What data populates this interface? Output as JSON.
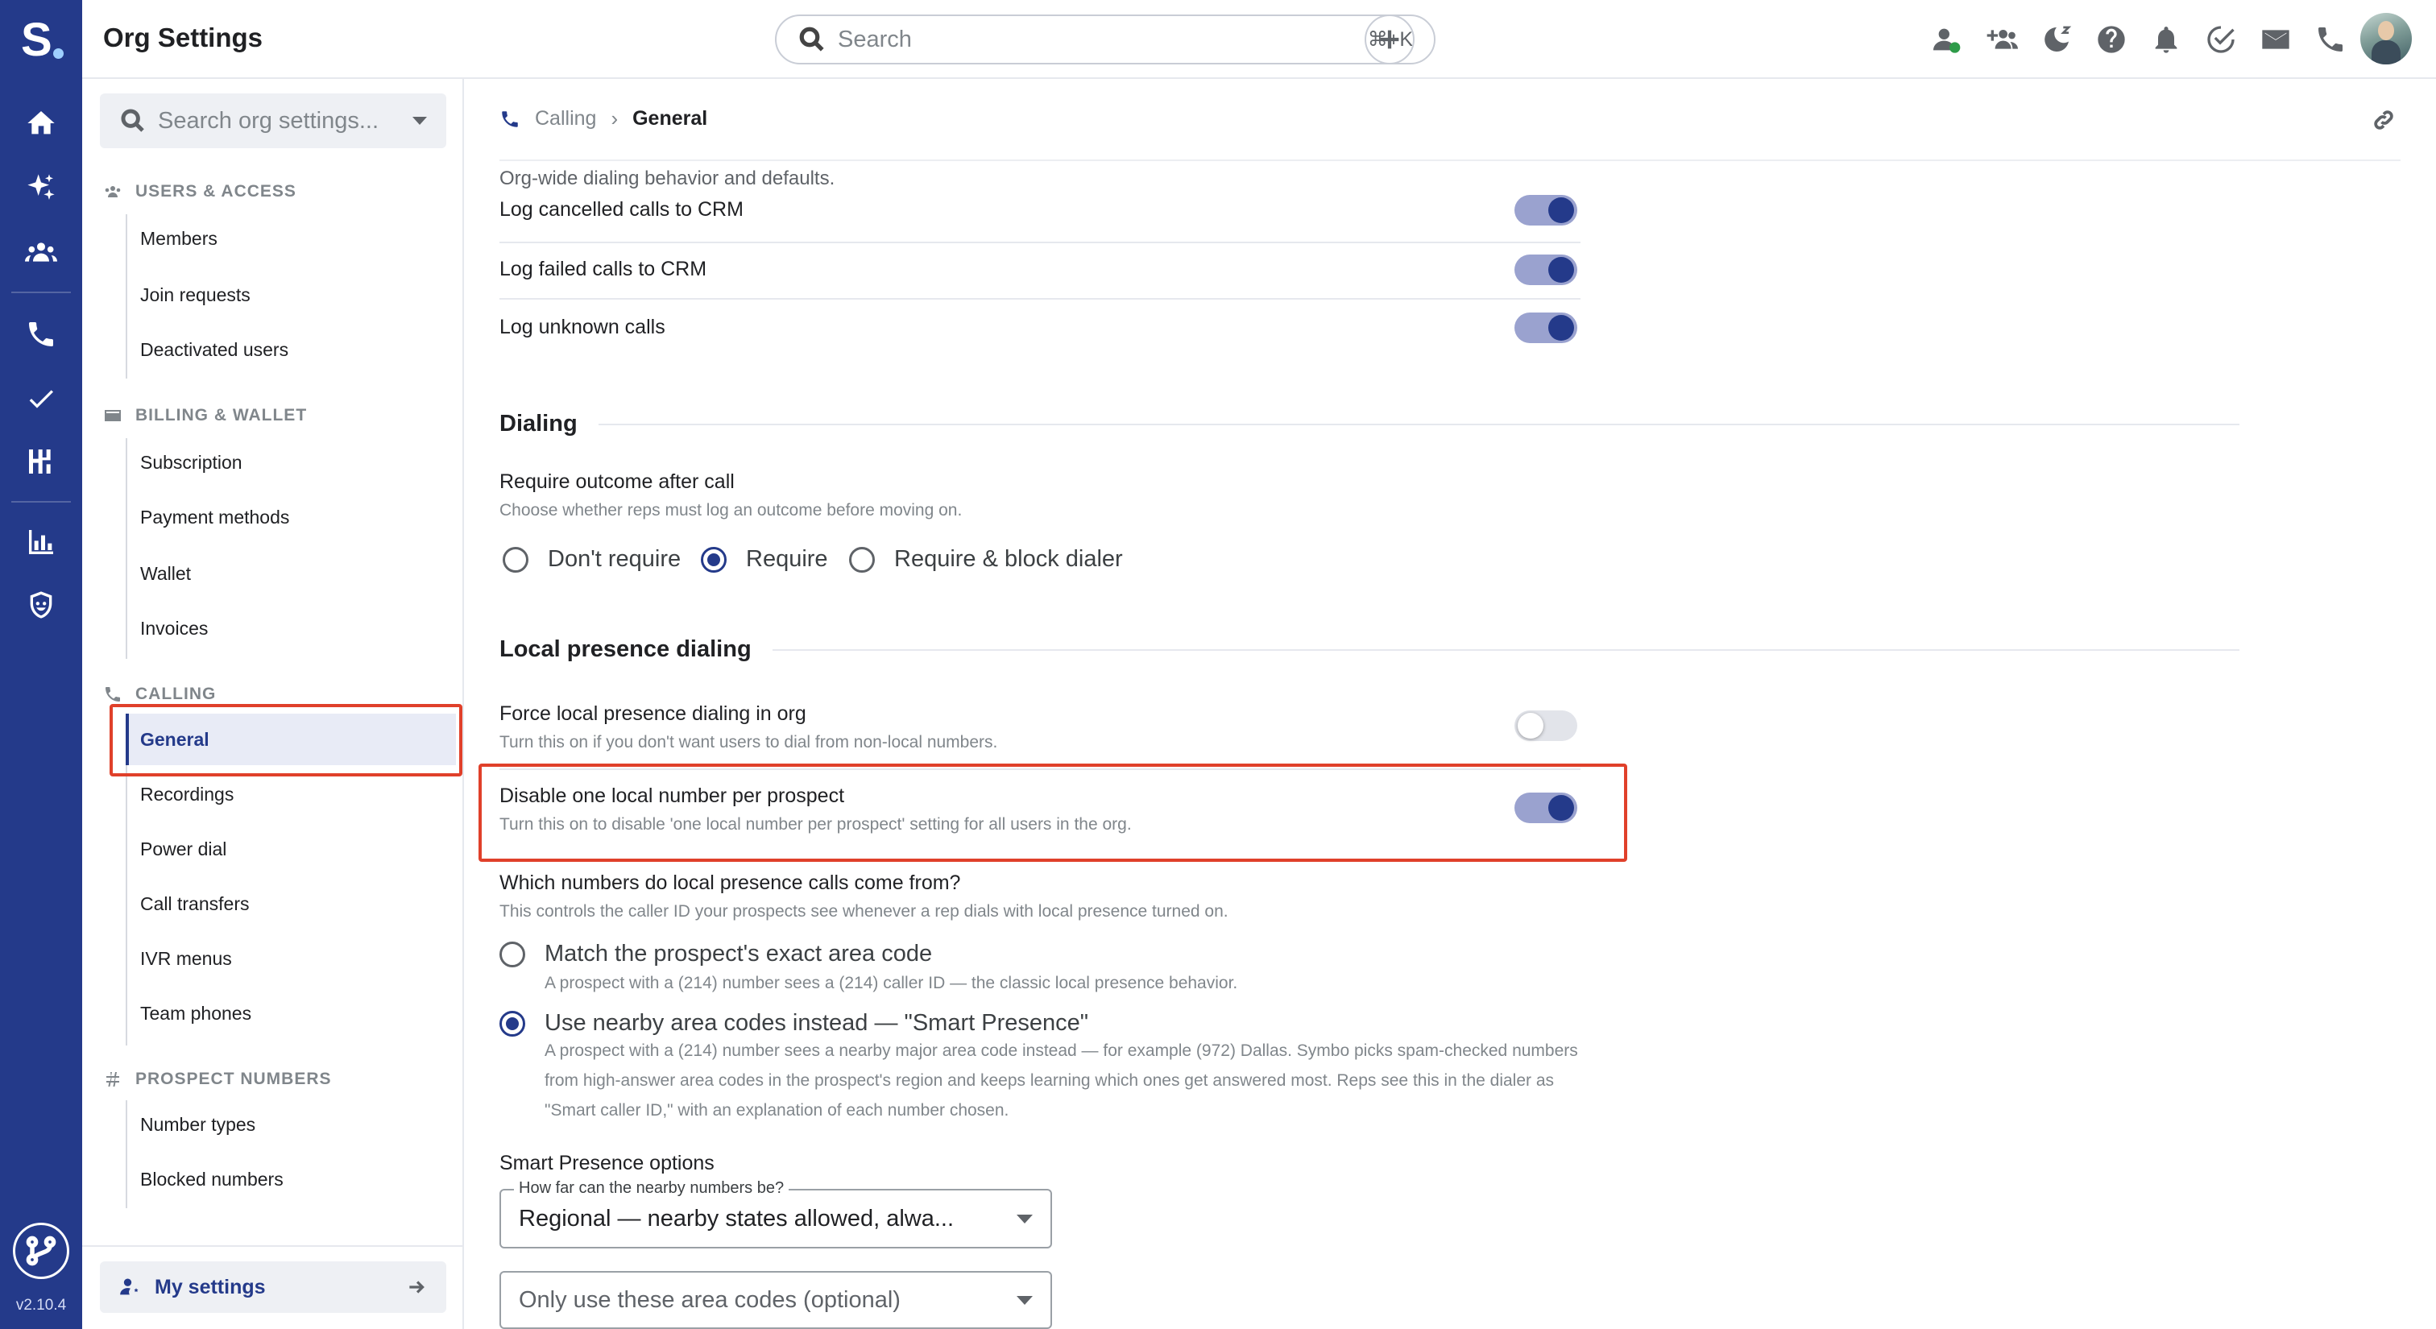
{
  "app": {
    "logo_letter": "S",
    "version": "v2.10.4"
  },
  "topbar": {
    "title": "Org Settings",
    "search_placeholder": "Search",
    "search_shortcut": "⌘+K"
  },
  "sidebar": {
    "search_placeholder": "Search org settings...",
    "sections": [
      {
        "title": "USERS & ACCESS",
        "icon": "users-icon",
        "items": [
          "Members",
          "Join requests",
          "Deactivated users"
        ]
      },
      {
        "title": "BILLING & WALLET",
        "icon": "card-icon",
        "items": [
          "Subscription",
          "Payment methods",
          "Wallet",
          "Invoices"
        ]
      },
      {
        "title": "CALLING",
        "icon": "phone-icon",
        "items": [
          "General",
          "Recordings",
          "Power dial",
          "Call transfers",
          "IVR menus",
          "Team phones"
        ]
      },
      {
        "title": "PROSPECT NUMBERS",
        "icon": "hash-icon",
        "items": [
          "Number types",
          "Blocked numbers"
        ]
      }
    ],
    "active_item": "General",
    "footer_label": "My settings"
  },
  "breadcrumb": {
    "parent": "Calling",
    "current": "General"
  },
  "intro": "Org-wide dialing behavior and defaults.",
  "crm_logging": [
    {
      "label": "Log cancelled calls to CRM",
      "on": true
    },
    {
      "label": "Log failed calls to CRM",
      "on": true
    },
    {
      "label": "Log unknown calls",
      "on": true
    }
  ],
  "dialing": {
    "title": "Dialing",
    "outcome_label": "Require outcome after call",
    "outcome_help": "Choose whether reps must log an outcome before moving on.",
    "options": [
      "Don't require",
      "Require",
      "Require & block dialer"
    ],
    "selected": "Require"
  },
  "local_presence": {
    "title": "Local presence dialing",
    "force": {
      "label": "Force local presence dialing in org",
      "help": "Turn this on if you don't want users to dial from non-local numbers.",
      "on": false
    },
    "disable_one": {
      "label": "Disable one local number per prospect",
      "help": "Turn this on to disable 'one local number per prospect' setting for all users in the org.",
      "on": true
    },
    "which_label": "Which numbers do local presence calls come from?",
    "which_help": "This controls the caller ID your prospects see whenever a rep dials with local presence turned on.",
    "match_label": "Match the prospect's exact area code",
    "match_help": "A prospect with a (214) number sees a (214) caller ID — the classic local presence behavior.",
    "nearby_label": "Use nearby area codes instead — \"Smart Presence\"",
    "nearby_help": "A prospect with a (214) number sees a nearby major area code instead — for example (972) Dallas. Symbo picks spam-checked numbers from high-answer area codes in the prospect's region and keeps learning which ones get answered most. Reps see this in the dialer as \"Smart caller ID,\" with an explanation of each number chosen.",
    "selected": "nearby"
  },
  "smart_presence": {
    "title": "Smart Presence options",
    "distance_label": "How far can the nearby numbers be?",
    "distance_value": "Regional — nearby states allowed, alwa...",
    "area_codes_placeholder": "Only use these area codes (optional)"
  },
  "colors": {
    "brand": "#243a8a",
    "highlight": "#e0402a"
  }
}
